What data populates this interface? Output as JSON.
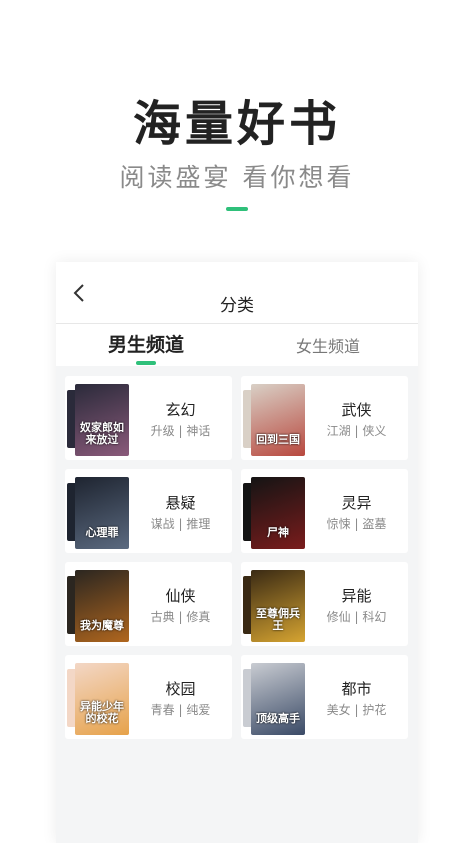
{
  "hero": {
    "title": "海量好书",
    "subtitle": "阅读盛宴 看你想看"
  },
  "app": {
    "back_icon": "chevron-left-icon",
    "title": "分类",
    "tabs": [
      {
        "label": "男生频道",
        "active": true
      },
      {
        "label": "女生频道",
        "active": false
      }
    ]
  },
  "categories": [
    {
      "name": "玄幻",
      "tags": "升级 | 神话",
      "cover_text": "奴家郎如来放过",
      "colors": [
        "#2a2a3a",
        "#8a5a7a"
      ]
    },
    {
      "name": "武侠",
      "tags": "江湖 | 侠义",
      "cover_text": "回到三国",
      "colors": [
        "#d9d0c6",
        "#b8483e"
      ]
    },
    {
      "name": "悬疑",
      "tags": "谋战 | 推理",
      "cover_text": "心理罪",
      "colors": [
        "#1e2430",
        "#5b6a80"
      ]
    },
    {
      "name": "灵异",
      "tags": "惊悚 | 盗墓",
      "cover_text": "尸神",
      "colors": [
        "#141414",
        "#7a1c1c"
      ]
    },
    {
      "name": "仙侠",
      "tags": "古典 | 修真",
      "cover_text": "我为魔尊",
      "colors": [
        "#2b2620",
        "#b0661e"
      ]
    },
    {
      "name": "异能",
      "tags": "修仙 | 科幻",
      "cover_text": "至尊佣兵王",
      "colors": [
        "#3a2a14",
        "#d6a431"
      ]
    },
    {
      "name": "校园",
      "tags": "青春 | 纯爱",
      "cover_text": "异能少年的校花",
      "colors": [
        "#f3d7c6",
        "#e6a24a"
      ]
    },
    {
      "name": "都市",
      "tags": "美女 | 护花",
      "cover_text": "顶级高手",
      "colors": [
        "#c9ccd2",
        "#3a4a66"
      ]
    }
  ],
  "accent_color": "#2fc07a"
}
